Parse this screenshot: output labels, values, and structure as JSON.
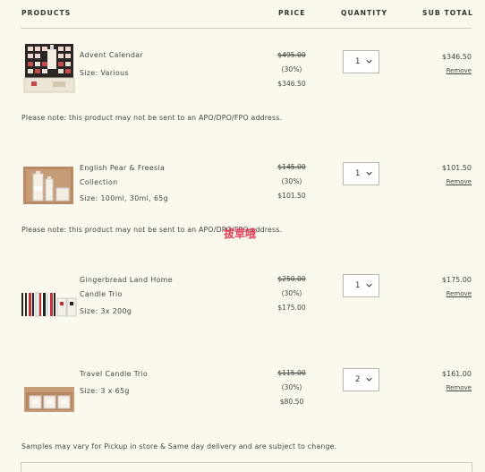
{
  "header": {
    "products": "PRODUCTS",
    "price": "PRICE",
    "quantity": "QUANTITY",
    "subtotal": "SUB TOTAL"
  },
  "items": [
    {
      "name": "Advent Calendar",
      "size": "Size: Various",
      "original_price": "$495.00",
      "discount": "(30%)",
      "price": "$346.50",
      "quantity": "1",
      "subtotal": "$346.50",
      "remove": "Remove"
    },
    {
      "name": "English Pear & Freesia Collection",
      "size": "Size: 100ml, 30ml, 65g",
      "original_price": "$145.00",
      "discount": "(30%)",
      "price": "$101.50",
      "quantity": "1",
      "subtotal": "$101.50",
      "remove": "Remove"
    },
    {
      "name": "Gingerbread Land Home Candle Trio",
      "size": "Size: 3x 200g",
      "original_price": "$250.00",
      "discount": "(30%)",
      "price": "$175.00",
      "quantity": "1",
      "subtotal": "$175.00",
      "remove": "Remove"
    },
    {
      "name": "Travel Candle Trio",
      "size": "Size: 3 x 65g",
      "original_price": "$115.00",
      "discount": "(30%)",
      "price": "$80.50",
      "quantity": "2",
      "subtotal": "$161.00",
      "remove": "Remove"
    }
  ],
  "notes": {
    "apo": "Please note: this product may not be sent to an APO/DPO/FPO address.",
    "samples": "Samples may vary for Pickup in store & Same day delivery and are subject to change."
  },
  "watermark": "拔草哦"
}
